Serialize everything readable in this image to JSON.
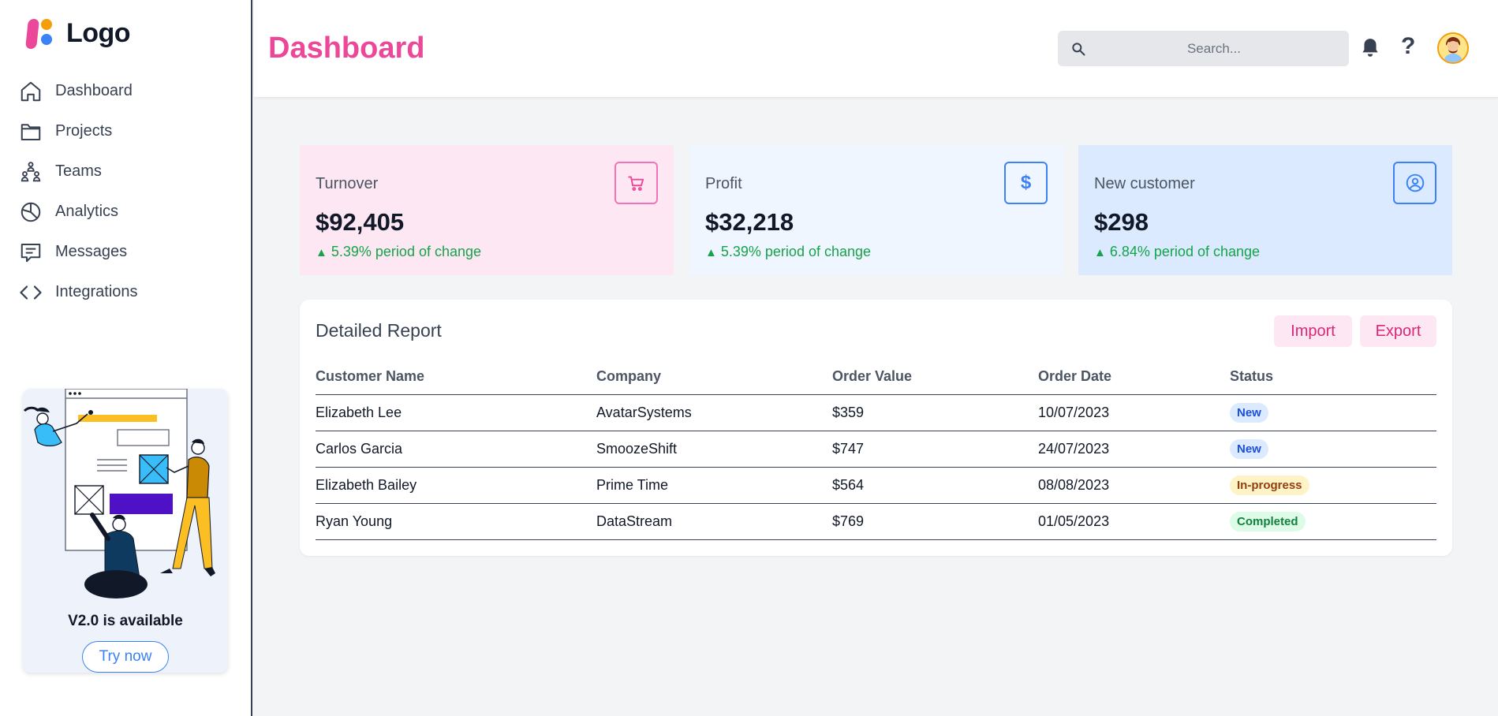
{
  "app": {
    "logo_text": "Logo"
  },
  "sidebar": {
    "items": [
      {
        "label": "Dashboard",
        "icon": "home-icon"
      },
      {
        "label": "Projects",
        "icon": "folder-icon"
      },
      {
        "label": "Teams",
        "icon": "teams-icon"
      },
      {
        "label": "Analytics",
        "icon": "pie-chart-icon"
      },
      {
        "label": "Messages",
        "icon": "message-icon"
      },
      {
        "label": "Integrations",
        "icon": "code-icon"
      }
    ],
    "promo": {
      "title": "V2.0 is available",
      "button_label": "Try now"
    }
  },
  "header": {
    "title": "Dashboard",
    "search_placeholder": "Search...",
    "help_symbol": "?"
  },
  "stats": [
    {
      "label": "Turnover",
      "value": "$92,405",
      "change": "5.39% period of change",
      "icon": "cart-icon"
    },
    {
      "label": "Profit",
      "value": "$32,218",
      "change": "5.39% period of change",
      "icon": "dollar-icon",
      "icon_text": "$"
    },
    {
      "label": "New customer",
      "value": "$298",
      "change": "6.84% period of change",
      "icon": "user-circle-icon"
    }
  ],
  "report": {
    "title": "Detailed Report",
    "import_label": "Import",
    "export_label": "Export",
    "columns": [
      "Customer Name",
      "Company",
      "Order Value",
      "Order Date",
      "Status"
    ],
    "rows": [
      {
        "name": "Elizabeth Lee",
        "company": "AvatarSystems",
        "value": "$359",
        "date": "10/07/2023",
        "status": "New"
      },
      {
        "name": "Carlos Garcia",
        "company": "SmoozeShift",
        "value": "$747",
        "date": "24/07/2023",
        "status": "New"
      },
      {
        "name": "Elizabeth Bailey",
        "company": "Prime Time",
        "value": "$564",
        "date": "08/08/2023",
        "status": "In-progress"
      },
      {
        "name": "Ryan Young",
        "company": "DataStream",
        "value": "$769",
        "date": "01/05/2023",
        "status": "Completed"
      }
    ]
  },
  "colors": {
    "accent": "#ec4899",
    "positive": "#16a34a",
    "primary": "#3b82f6"
  }
}
